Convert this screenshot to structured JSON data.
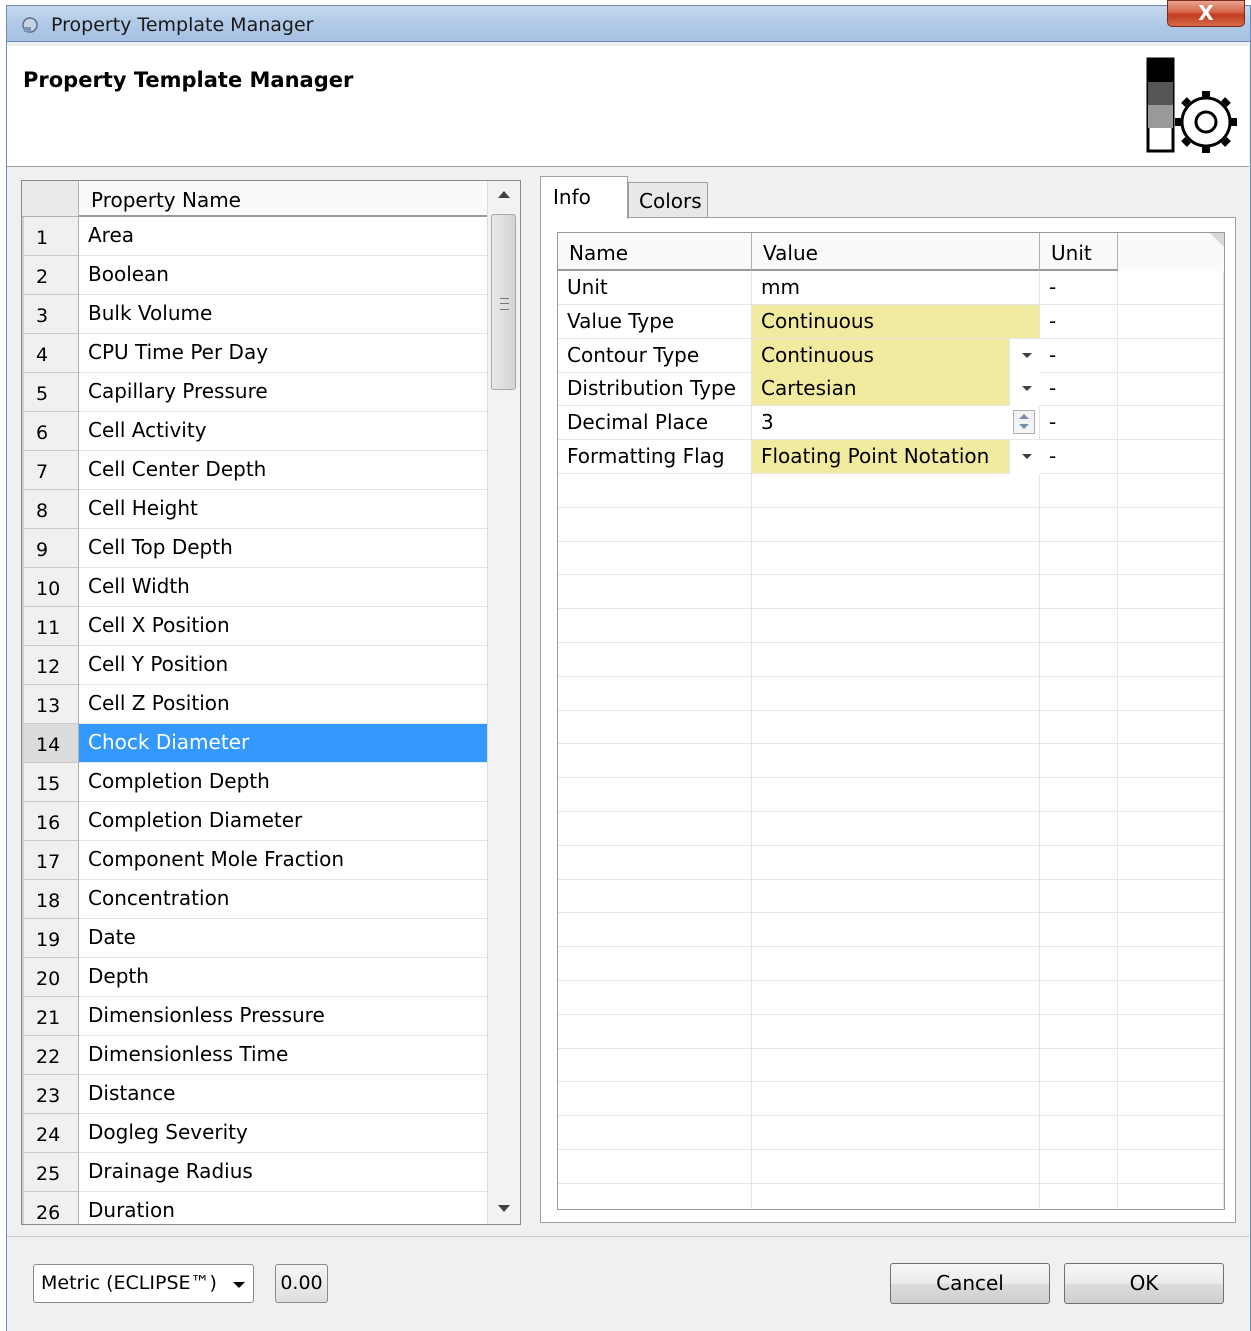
{
  "window": {
    "title": "Property Template Manager",
    "close_label": "X"
  },
  "header": {
    "title": "Property Template Manager"
  },
  "property_list": {
    "column_header": "Property Name",
    "selected_index": 14,
    "rows": [
      {
        "num": "1",
        "name": "Area"
      },
      {
        "num": "2",
        "name": "Boolean"
      },
      {
        "num": "3",
        "name": "Bulk Volume"
      },
      {
        "num": "4",
        "name": "CPU Time Per Day"
      },
      {
        "num": "5",
        "name": "Capillary Pressure"
      },
      {
        "num": "6",
        "name": "Cell Activity"
      },
      {
        "num": "7",
        "name": "Cell Center Depth"
      },
      {
        "num": "8",
        "name": "Cell Height"
      },
      {
        "num": "9",
        "name": "Cell Top Depth"
      },
      {
        "num": "10",
        "name": "Cell Width"
      },
      {
        "num": "11",
        "name": "Cell X Position"
      },
      {
        "num": "12",
        "name": "Cell Y Position"
      },
      {
        "num": "13",
        "name": "Cell Z Position"
      },
      {
        "num": "14",
        "name": "Chock Diameter"
      },
      {
        "num": "15",
        "name": "Completion Depth"
      },
      {
        "num": "16",
        "name": "Completion Diameter"
      },
      {
        "num": "17",
        "name": "Component Mole Fraction"
      },
      {
        "num": "18",
        "name": "Concentration"
      },
      {
        "num": "19",
        "name": "Date"
      },
      {
        "num": "20",
        "name": "Depth"
      },
      {
        "num": "21",
        "name": "Dimensionless Pressure"
      },
      {
        "num": "22",
        "name": "Dimensionless Time"
      },
      {
        "num": "23",
        "name": "Distance"
      },
      {
        "num": "24",
        "name": "Dogleg Severity"
      },
      {
        "num": "25",
        "name": "Drainage Radius"
      },
      {
        "num": "26",
        "name": "Duration"
      }
    ]
  },
  "tabs": {
    "info": "Info",
    "colors": "Colors",
    "active": "Info"
  },
  "info_table": {
    "headers": {
      "name": "Name",
      "value": "Value",
      "unit": "Unit"
    },
    "rows": [
      {
        "name": "Unit",
        "value": "mm",
        "unit": "-",
        "editor": "text",
        "highlight": false
      },
      {
        "name": "Value Type",
        "value": "Continuous",
        "unit": "-",
        "editor": "text",
        "highlight": true
      },
      {
        "name": "Contour Type",
        "value": "Continuous",
        "unit": "-",
        "editor": "dropdown",
        "highlight": true
      },
      {
        "name": "Distribution Type",
        "value": "Cartesian",
        "unit": "-",
        "editor": "dropdown",
        "highlight": true
      },
      {
        "name": "Decimal Place",
        "value": "3",
        "unit": "-",
        "editor": "spinner",
        "highlight": false
      },
      {
        "name": "Formatting Flag",
        "value": "Floating Point Notation",
        "unit": "-",
        "editor": "dropdown",
        "highlight": true
      }
    ]
  },
  "footer": {
    "unit_system": "Metric (ECLIPSE™)",
    "value_button": "0.00",
    "cancel": "Cancel",
    "ok": "OK"
  },
  "colors": {
    "selection": "#3399ff",
    "highlight_cell": "#f0eb9e",
    "titlebar": "#b3cbe8"
  }
}
